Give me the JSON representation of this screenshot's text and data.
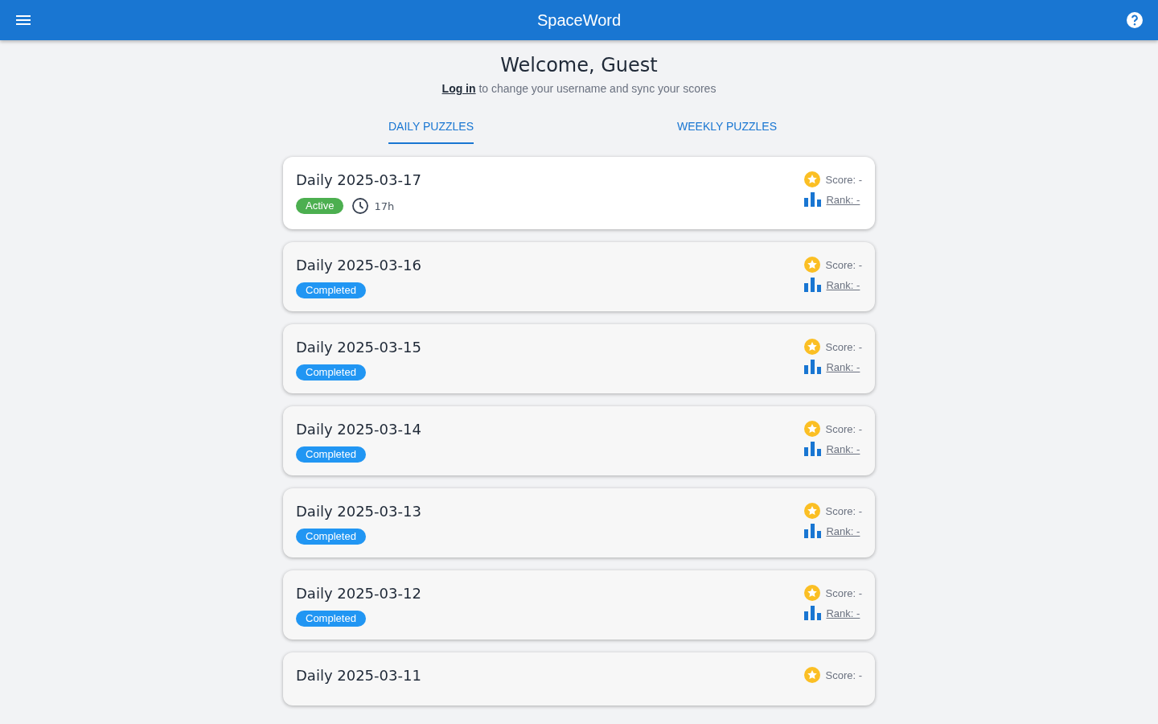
{
  "app_bar": {
    "title": "SpaceWord"
  },
  "welcome": {
    "heading": "Welcome, Guest",
    "login_link": "Log in",
    "login_text": "to change your username and sync your scores"
  },
  "tabs": [
    {
      "label": "DAILY PUZZLES",
      "selected": true
    },
    {
      "label": "WEEKLY PUZZLES",
      "selected": false
    }
  ],
  "puzzles": [
    {
      "title": "Daily 2025-03-17",
      "status": "Active",
      "kind": "active",
      "time_left": "17h",
      "score": "Score: -",
      "rank": "Rank: -"
    },
    {
      "title": "Daily 2025-03-16",
      "status": "Completed",
      "kind": "completed",
      "score": "Score: -",
      "rank": "Rank: -"
    },
    {
      "title": "Daily 2025-03-15",
      "status": "Completed",
      "kind": "completed",
      "score": "Score: -",
      "rank": "Rank: -"
    },
    {
      "title": "Daily 2025-03-14",
      "status": "Completed",
      "kind": "completed",
      "score": "Score: -",
      "rank": "Rank: -"
    },
    {
      "title": "Daily 2025-03-13",
      "status": "Completed",
      "kind": "completed",
      "score": "Score: -",
      "rank": "Rank: -"
    },
    {
      "title": "Daily 2025-03-12",
      "status": "Completed",
      "kind": "completed",
      "score": "Score: -",
      "rank": "Rank: -"
    },
    {
      "title": "Daily 2025-03-11",
      "kind": "completed",
      "score": "Score: -"
    }
  ]
}
